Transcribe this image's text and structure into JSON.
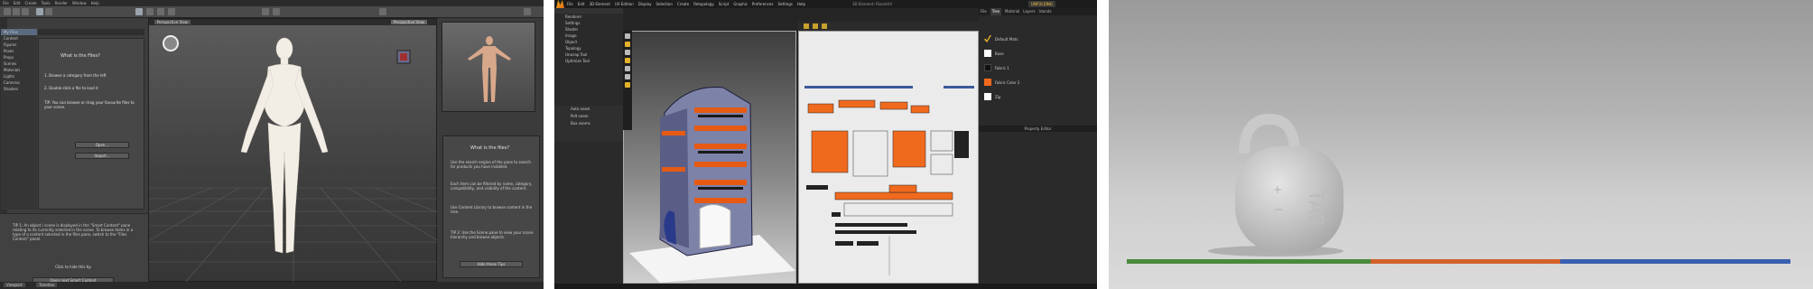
{
  "panel1": {
    "menus": [
      "File",
      "Edit",
      "Create",
      "Tools",
      "Render",
      "Window",
      "Help"
    ],
    "left_tree": [
      "My Files",
      "Content",
      "Figures",
      "Poses",
      "Props",
      "Scenes",
      "Materials",
      "Lights",
      "Cameras",
      "Shaders"
    ],
    "left_title": "What is the Files?",
    "left_step1": "1. Browse a category from the left",
    "left_step2": "2. Double-click a file to load it",
    "left_note": "TIP: You can browse or drag your favourite files to your scene.",
    "btn_open": "Open...",
    "btn_import": "Import...",
    "tip_text": "TIP 1: An object / scene is displayed in the \"Smart Content\" pane relating to its currently selected in the scene. To browse items in a type of a content selected in the files pane, switch to the \"Files Content\" panel.",
    "tip_link1": "Click to hide this tip",
    "tip_link2": "Open next Smart Content",
    "viewport_tab": "Perspective View",
    "rp_title": "What is the files?",
    "rp_text1": "Use the search engine of the pane to search for products you have installed.",
    "rp_text2": "Each item can be filtered by name, category, compatibility, and visibility of the content.",
    "rp_text3": "Use Content Library to browse content in the tree.",
    "rp_tip": "TIP 2: Use the Scene pane to view your scene hierarchy and browse objects.",
    "rp_link": "Hide these Tips",
    "status_btn1": "Viewport",
    "status_btn2": "Timeline",
    "colors": {
      "bg": "#3a3a3a",
      "viewport": "#4a4a4a",
      "figure": "#f2eee6"
    }
  },
  "panel2": {
    "menus": [
      "File",
      "Edit",
      "3D Element",
      "UV Edition",
      "Display",
      "Selection",
      "Create",
      "Retopology",
      "Script",
      "Graphic",
      "Preferences",
      "Settings",
      "Help"
    ],
    "app_title": "3D Element: RizomUV",
    "badge": "UNFOLDING",
    "left_items": [
      "Renderer",
      "Settings",
      "Shader",
      "Image",
      "Object",
      "Topology",
      "Unwrap Tool",
      "Optimize Tool"
    ],
    "left_section": [
      "Auto seam",
      "Pelt seam",
      "Box seams"
    ],
    "right_tabs": [
      "File",
      "Tree",
      "Material",
      "Layers",
      "Islands"
    ],
    "materials": [
      {
        "name": "Default Mats",
        "color": "#2a2a2a"
      },
      {
        "name": "Base",
        "color": "#ffffff"
      },
      {
        "name": "Fabric 1",
        "color": "#111111"
      },
      {
        "name": "Fabric Color 2",
        "color": "#f06a1e"
      },
      {
        "name": "Zip",
        "color": "#ffffff"
      }
    ],
    "prop_title": "Property Editor",
    "colors": {
      "accent": "#e6b22b",
      "orange": "#f06a1e",
      "uv_bg": "#ebebeb"
    }
  },
  "panel3": {
    "object_text": "TAR",
    "colors": {
      "x_axis": "#4a8a3c",
      "y_axis": "#d2602a",
      "z_axis": "#3a5fb0",
      "object": "#d6d6d6"
    }
  }
}
